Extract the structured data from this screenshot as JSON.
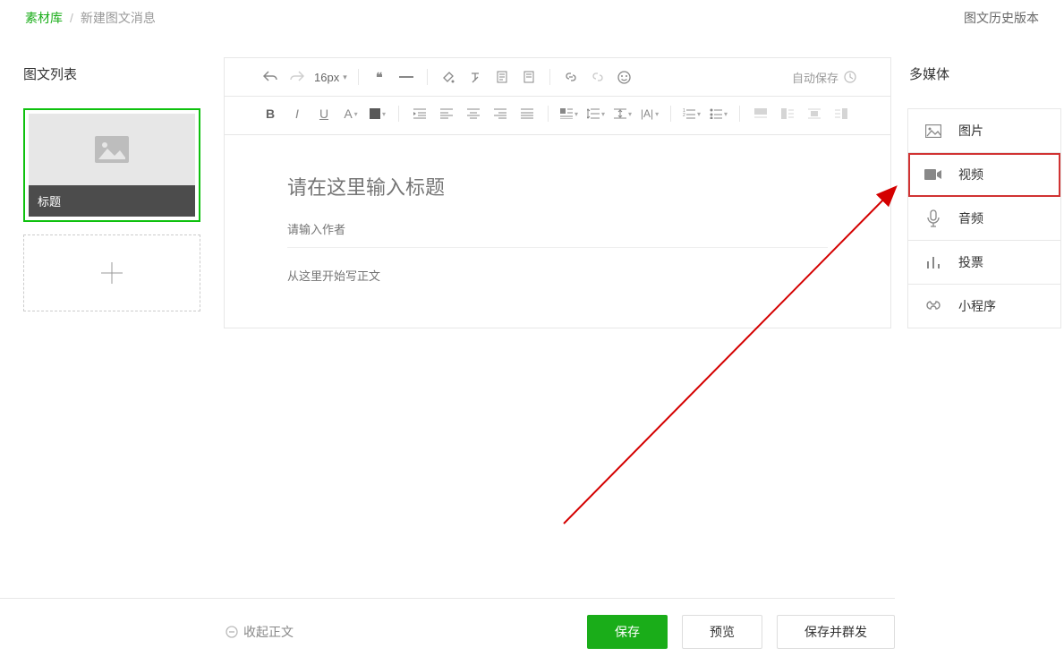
{
  "breadcrumb": {
    "root": "素材库",
    "current": "新建图文消息",
    "history": "图文历史版本"
  },
  "left": {
    "title": "图文列表",
    "card_title": "标题"
  },
  "toolbar": {
    "font_size": "16px",
    "autosave": "自动保存"
  },
  "editor": {
    "title_placeholder": "请在这里输入标题",
    "author_placeholder": "请输入作者",
    "content_placeholder": "从这里开始写正文"
  },
  "right": {
    "title": "多媒体",
    "items": [
      {
        "label": "图片"
      },
      {
        "label": "视频"
      },
      {
        "label": "音频"
      },
      {
        "label": "投票"
      },
      {
        "label": "小程序"
      }
    ]
  },
  "footer": {
    "collapse": "收起正文",
    "save": "保存",
    "preview": "预览",
    "save_send": "保存并群发"
  }
}
